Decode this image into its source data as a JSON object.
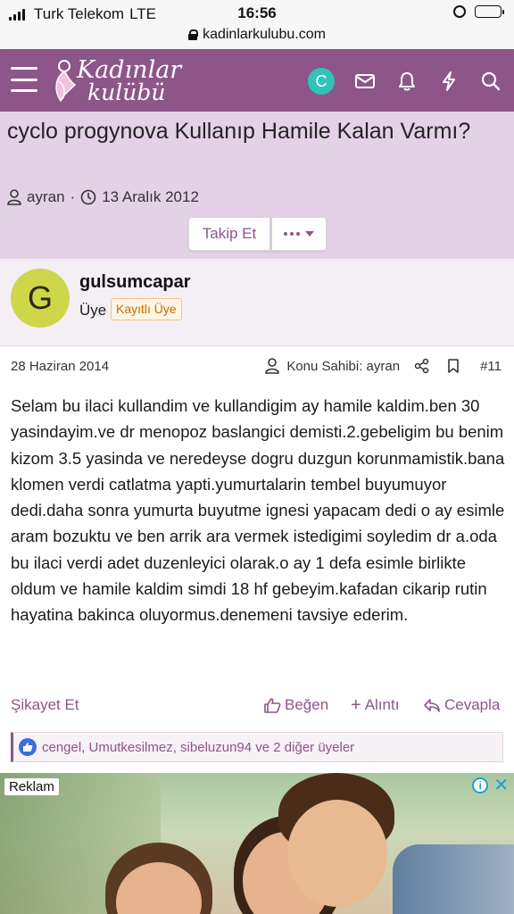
{
  "status": {
    "carrier": "Turk Telekom",
    "network": "LTE",
    "time": "16:56"
  },
  "url": "kadinlarkulubu.com",
  "header": {
    "logo_line1": "Kadınlar",
    "logo_line2": "kulübü",
    "user_initial": "C",
    "brand_color": "#8e5589",
    "icons": [
      "envelope-icon",
      "bell-icon",
      "bolt-icon",
      "search-icon"
    ]
  },
  "thread": {
    "title": "cyclo progynova Kullanıp Hamile Kalan Varmı?",
    "author": "ayran",
    "date": "13 Aralık 2012",
    "follow_label": "Takip Et"
  },
  "post": {
    "user": {
      "initial": "G",
      "name": "gulsumcapar",
      "role": "Üye",
      "badge": "Kayıtlı Üye"
    },
    "date": "28 Haziran 2014",
    "thread_owner": "Konu Sahibi: ayran",
    "number": "#11",
    "body": "Selam bu ilaci kullandim ve kullandigim ay hamile kaldim.ben 30 yasindayim.ve dr menopoz baslangici demisti.2.gebeligim bu benim kizom 3.5 yasinda ve neredeyse dogru duzgun korunmamistik.bana klomen verdi catlatma yapti.yumurtalarin tembel buyumuyor dedi.daha sonra yumurta buyutme ignesi yapacam dedi o ay esimle aram bozuktu ve ben arrik ara vermek istedigimi soyledim dr a.oda bu ilaci verdi adet duzenleyici olarak.o ay 1 defa esimle birlikte oldum ve hamile kaldim simdi 18 hf gebeyim.kafadan cikarip rutin hayatina bakinca oluyormus.denemeni tavsiye ederim.",
    "actions": {
      "report": "Şikayet Et",
      "like": "Beğen",
      "quote": "Alıntı",
      "reply": "Cevapla"
    },
    "likes": "cengel, Umutkesilmez, sibeluzun94 ve 2 diğer üyeler"
  },
  "ad": {
    "label": "Reklam"
  }
}
